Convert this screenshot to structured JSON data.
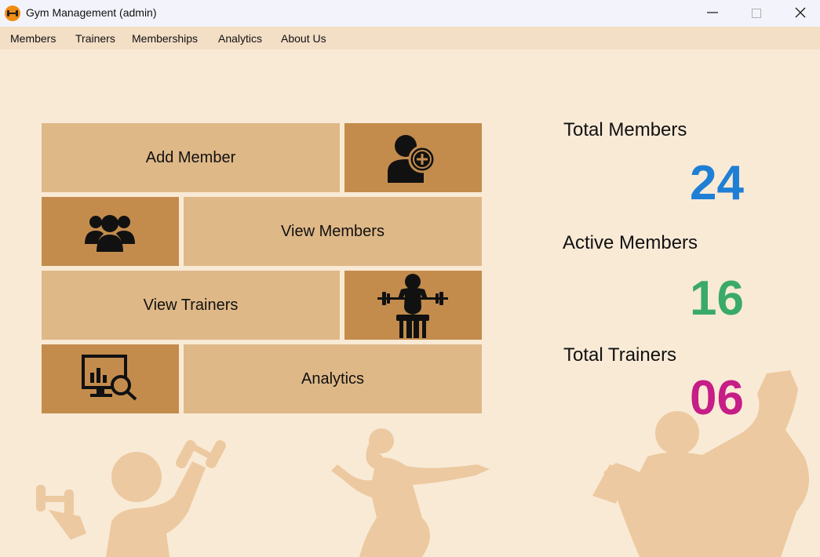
{
  "window": {
    "title": "Gym Management (admin)"
  },
  "menu": [
    "Members",
    "Trainers",
    "Memberships",
    "Analytics",
    "About Us"
  ],
  "tiles": {
    "add_member": "Add Member",
    "view_members": "View Members",
    "view_trainers": "View Trainers",
    "analytics": "Analytics"
  },
  "stats": {
    "total_members": {
      "label": "Total Members",
      "value": "24",
      "color": "#1f7fd4"
    },
    "active_members": {
      "label": "Active Members",
      "value": "16",
      "color": "#3aaa68"
    },
    "total_trainers": {
      "label": "Total Trainers",
      "value": "06",
      "color": "#c61d86"
    }
  },
  "icons": {
    "add_member": "add-user-icon",
    "view_members": "user-group-icon",
    "view_trainers": "weightlifter-icon",
    "analytics": "chart-search-icon"
  },
  "colors": {
    "background": "#f9ead6",
    "tile_light": "#dfb888",
    "tile_dark": "#c38c4d"
  }
}
